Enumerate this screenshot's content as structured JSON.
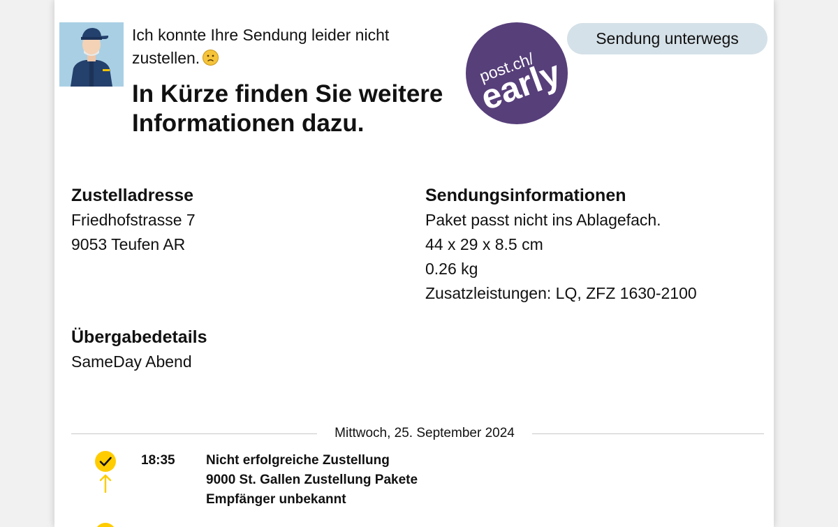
{
  "message": {
    "intro": "Ich konnte Ihre Sendung leider nicht zustellen.",
    "emoji_icon": "sad-face-icon",
    "headline": "In Kürze finden Sie weitere Informationen dazu."
  },
  "promo": {
    "line1": "post.ch/",
    "line2": "early",
    "color": "#573f7a"
  },
  "status": {
    "label": "Sendung unterwegs",
    "color": "#d5e1e8"
  },
  "delivery_address": {
    "title": "Zustelladresse",
    "street": "Friedhofstrasse 7",
    "city": "9053 Teufen AR"
  },
  "shipment_info": {
    "title": "Sendungsinformationen",
    "lines": [
      "Paket passt nicht ins Ablagefach.",
      "44 x 29 x 8.5 cm",
      "0.26 kg",
      "Zusatzleistungen: LQ, ZFZ 1630-2100"
    ]
  },
  "handover": {
    "title": "Übergabedetails",
    "value": "SameDay Abend"
  },
  "timeline": {
    "date": "Mittwoch, 25. September 2024",
    "accent": "#ffcc00",
    "events": [
      {
        "icon": "checkmark-icon",
        "time": "18:35",
        "title": "Nicht erfolgreiche Zustellung",
        "location": "9000 St. Gallen Zustellung Pakete",
        "note": "Empfänger unbekannt"
      }
    ]
  }
}
